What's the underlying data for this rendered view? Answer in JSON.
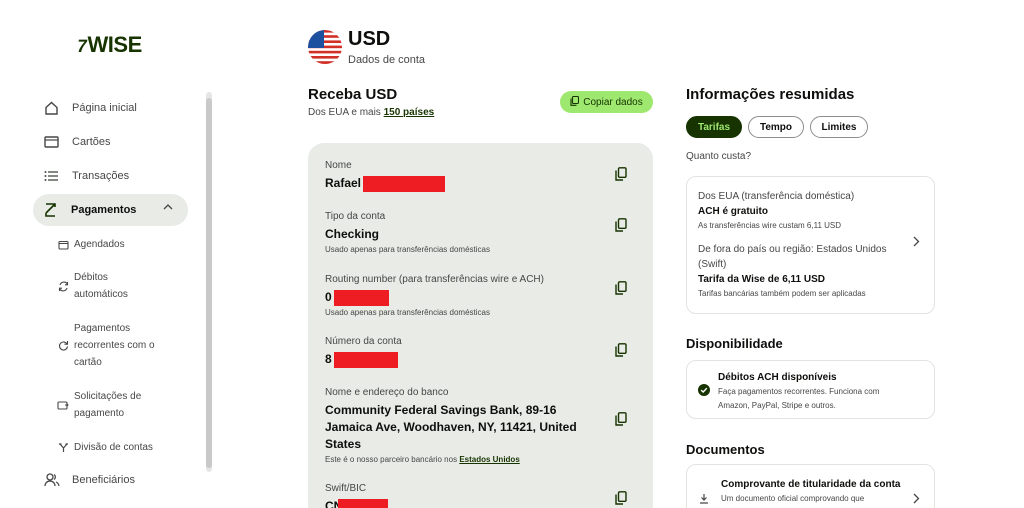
{
  "brand": {
    "logo_text": "WISE",
    "logo_mark": "7"
  },
  "sidebar": {
    "items": [
      {
        "label": "Página inicial",
        "icon": "home-icon"
      },
      {
        "label": "Cartões",
        "icon": "card-icon"
      },
      {
        "label": "Transações",
        "icon": "list-icon"
      },
      {
        "label": "Pagamentos",
        "icon": "payments-icon",
        "active": true
      },
      {
        "label": "Beneficiários",
        "icon": "people-icon"
      }
    ],
    "subitems": [
      {
        "lines": [
          "Agendados"
        ],
        "icon": "calendar-icon"
      },
      {
        "lines": [
          "Débitos",
          "automáticos"
        ],
        "icon": "refresh-icon"
      },
      {
        "lines": [
          "Pagamentos",
          "recorrentes com o",
          "cartão"
        ],
        "icon": "recurring-icon"
      },
      {
        "lines": [
          "Solicitações de",
          "pagamento"
        ],
        "icon": "request-icon"
      },
      {
        "lines": [
          "Divisão de contas"
        ],
        "icon": "split-icon"
      }
    ]
  },
  "header": {
    "currency": "USD",
    "subtitle": "Dados de conta"
  },
  "receive": {
    "title": "Receba USD",
    "subtitle_prefix": "Dos EUA e mais",
    "subtitle_link": "150 países",
    "copy_button": "Copiar dados"
  },
  "fields": [
    {
      "label": "Nome",
      "value": "Rafael"
    },
    {
      "label": "Tipo da conta",
      "value": "Checking",
      "note": "Usado apenas para transferências domésticas"
    },
    {
      "label": "Routing number (para transferências wire e ACH)",
      "value": "0",
      "note": "Usado apenas para transferências domésticas"
    },
    {
      "label": "Número da conta",
      "value": "8"
    },
    {
      "label": "Nome e endereço do banco",
      "value_lines": [
        "Community Federal Savings Bank, 89-16",
        "Jamaica Ave, Woodhaven, NY, 11421, United",
        "States"
      ],
      "note_prefix": "Este é o nosso parceiro bancário nos",
      "note_link": "Estados Unidos"
    },
    {
      "label": "Swift/BIC",
      "value": "CN"
    }
  ],
  "summary": {
    "title": "Informações resumidas",
    "tabs": [
      "Tarifas",
      "Tempo",
      "Limites"
    ],
    "question": "Quanto custa?",
    "fees": {
      "domestic_title": "Dos EUA (transferência doméstica)",
      "domestic_strong": "ACH é gratuito",
      "domestic_note": "As transferências wire custam 6,11 USD",
      "intl_title_1": "De fora do país ou região: Estados Unidos",
      "intl_title_2": "(Swift)",
      "intl_strong": "Tarifa da Wise de 6,11 USD",
      "intl_note": "Tarifas bancárias também podem ser aplicadas"
    },
    "availability_title": "Disponibilidade",
    "availability": {
      "strong": "Débitos ACH disponíveis",
      "note_1": "Faça pagamentos recorrentes. Funciona com",
      "note_2": "Amazon, PayPal, Stripe e outros."
    },
    "documents_title": "Documentos",
    "document": {
      "strong": "Comprovante de titularidade da conta",
      "note": "Um documento oficial comprovando que"
    }
  },
  "colors": {
    "accent": "#9fe870",
    "dark_green": "#163300",
    "redaction": "#ee1d23",
    "card_bg": "#e8ebe6"
  }
}
